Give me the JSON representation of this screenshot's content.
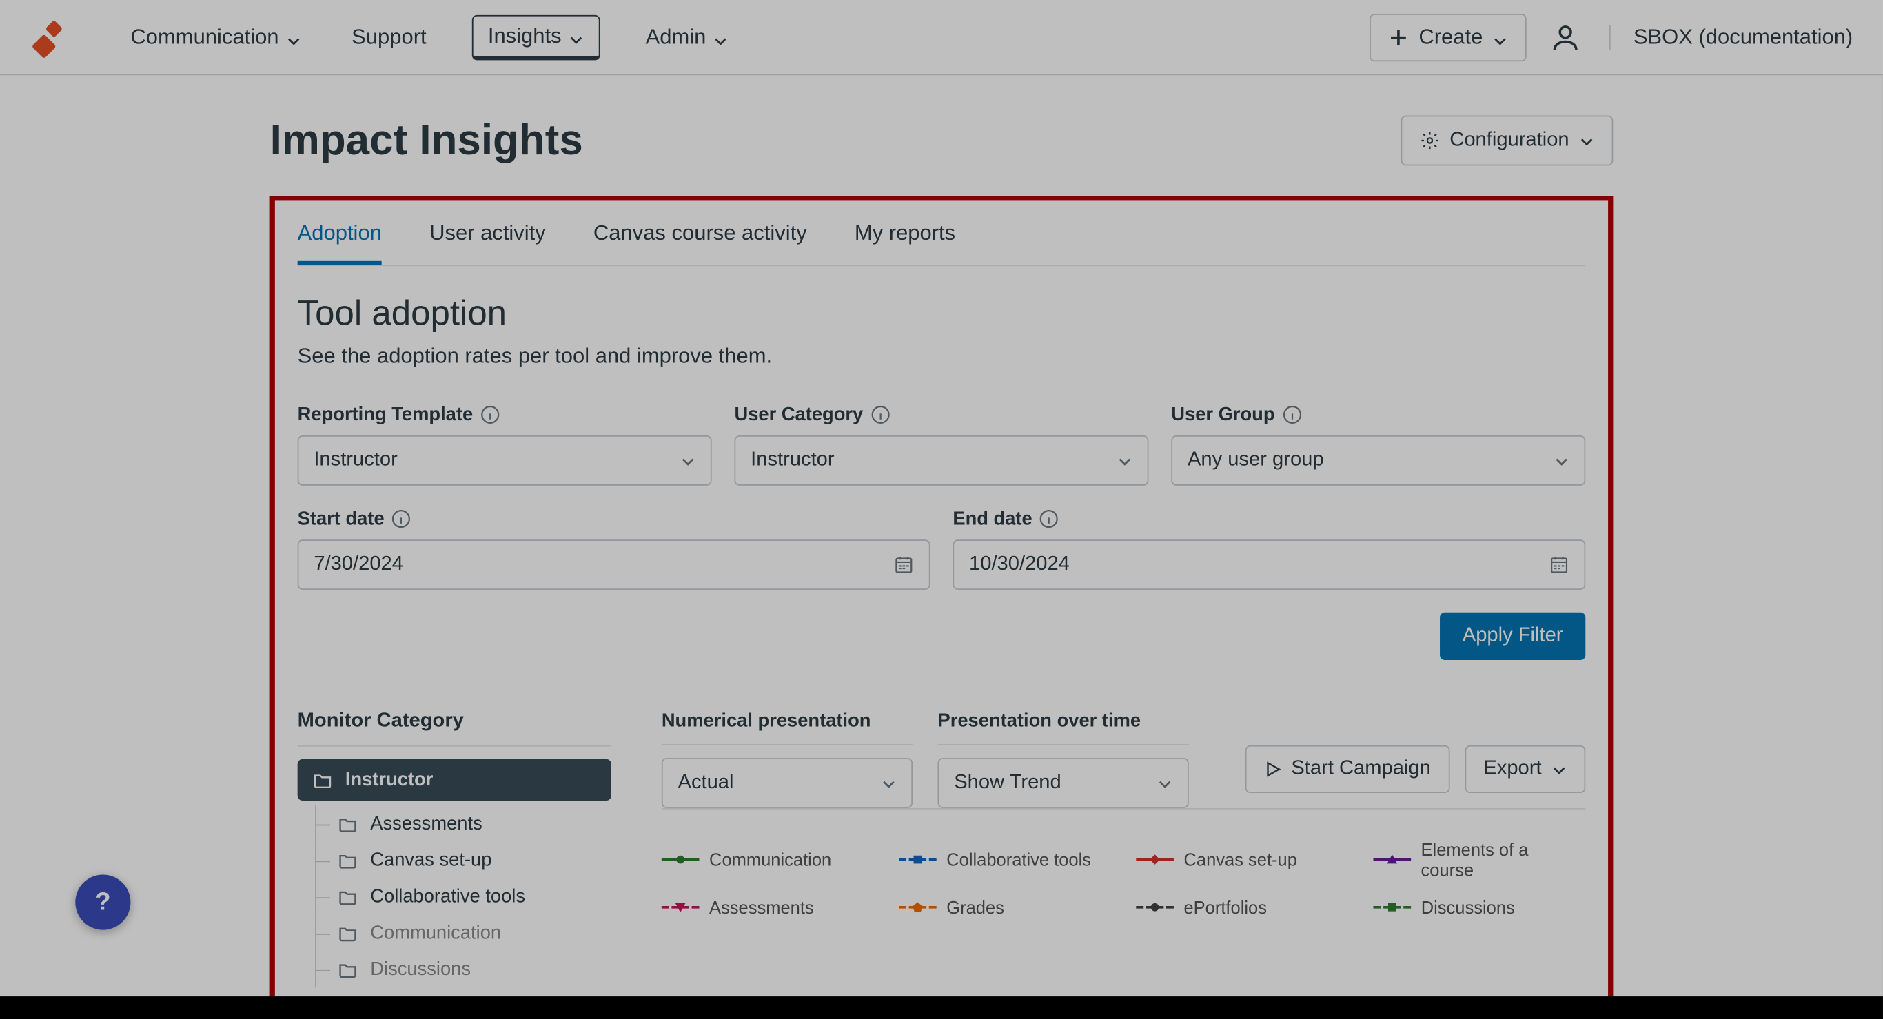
{
  "topnav": {
    "items": [
      "Communication",
      "Support",
      "Insights",
      "Admin"
    ],
    "active": "Insights",
    "create": "Create",
    "tenant": "SBOX (documentation)"
  },
  "page": {
    "title": "Impact Insights",
    "config": "Configuration"
  },
  "tabs": [
    "Adoption",
    "User activity",
    "Canvas course activity",
    "My reports"
  ],
  "active_tab": "Adoption",
  "section": {
    "title": "Tool adoption",
    "desc": "See the adoption rates per tool and improve them."
  },
  "filters": {
    "reporting_template": {
      "label": "Reporting Template",
      "value": "Instructor"
    },
    "user_category": {
      "label": "User Category",
      "value": "Instructor"
    },
    "user_group": {
      "label": "User Group",
      "value": "Any user group"
    },
    "start_date": {
      "label": "Start date",
      "value": "7/30/2024"
    },
    "end_date": {
      "label": "End date",
      "value": "10/30/2024"
    },
    "apply": "Apply Filter"
  },
  "monitor": {
    "title": "Monitor Category",
    "root": "Instructor",
    "items": [
      "Assessments",
      "Canvas set-up",
      "Collaborative tools",
      "Communication",
      "Discussions"
    ]
  },
  "presentation": {
    "numerical": {
      "label": "Numerical presentation",
      "value": "Actual"
    },
    "over_time": {
      "label": "Presentation over time",
      "value": "Show Trend"
    },
    "start_campaign": "Start Campaign",
    "export": "Export"
  },
  "legend": [
    {
      "label": "Communication",
      "color": "#2e7d32",
      "shape": "circle",
      "dashed": false
    },
    {
      "label": "Collaborative tools",
      "color": "#1565c0",
      "shape": "square",
      "dashed": true
    },
    {
      "label": "Canvas set-up",
      "color": "#d32f2f",
      "shape": "diamond",
      "dashed": false
    },
    {
      "label": "Elements of a course",
      "color": "#6a1b9a",
      "shape": "triangle",
      "dashed": false
    },
    {
      "label": "Assessments",
      "color": "#c2185b",
      "shape": "tridown",
      "dashed": true
    },
    {
      "label": "Grades",
      "color": "#ef6c00",
      "shape": "pentagon",
      "dashed": true
    },
    {
      "label": "ePortfolios",
      "color": "#424242",
      "shape": "circle",
      "dashed": true
    },
    {
      "label": "Discussions",
      "color": "#2e7d32",
      "shape": "square",
      "dashed": true
    }
  ],
  "help": "?"
}
